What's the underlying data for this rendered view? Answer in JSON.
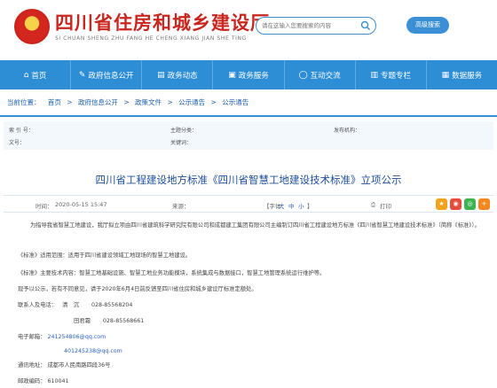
{
  "header": {
    "site_title": "四川省住房和城乡建设厅",
    "site_subtitle": "SI CHUAN SHENG ZHU FANG HE CHENG XIANG JIAN SHE TING",
    "search_placeholder": "请在这输入您要搜索的内容",
    "advanced_search": "高级搜索"
  },
  "nav": {
    "items": [
      {
        "icon": "home-icon",
        "label": "首页"
      },
      {
        "icon": "edit-icon",
        "label": "政府信息公开"
      },
      {
        "icon": "news-icon",
        "label": "政务动态"
      },
      {
        "icon": "service-icon",
        "label": "政务服务"
      },
      {
        "icon": "chat-icon",
        "label": "互动交流"
      },
      {
        "icon": "topic-icon",
        "label": "专题专栏"
      },
      {
        "icon": "data-icon",
        "label": "数据服务"
      }
    ]
  },
  "breadcrumb": {
    "prefix": "当前位置：",
    "items": [
      "首页",
      "政府信息公开",
      "政策文件",
      "公示通告",
      "公示通告"
    ],
    "separator": ">"
  },
  "meta": {
    "index_label": "索 引 号：",
    "index_value": "",
    "category_label": "主题分类：",
    "category_value": "",
    "org_label": "发布机构：",
    "org_value": "",
    "doc_no_label": "文号：",
    "doc_no_value": "",
    "keywords_label": "关键词：",
    "keywords_value": ""
  },
  "article": {
    "title": "四川省工程建设地方标准《四川省智慧工地建设技术标准》立项公示",
    "time_label": "时间：",
    "time_value": "2020-05-15 15:47",
    "source_label": "来源：",
    "source_value": "",
    "font_label": "【字体：",
    "font_options": [
      "大",
      "中",
      "小"
    ],
    "font_close": "】",
    "print_label": "打印",
    "paragraphs": {
      "p1": "为指导我省智慧工地建设，我厅拟立项由四川省建筑科学研究院有限公司和成都建工集团有限公司主编制订四川省工程建设地方标准《四川省智慧工地建设技术标准》（简称《标准》）。",
      "p2": "《标准》适用范围：适用于四川省建设领域工地现场的智慧工地建设。",
      "p3": "《标准》主要技术内容：智慧工地基础设施、智慧工地业务功能模块，系统集成与数据接口，智慧工地管理系统运行维护等。",
      "p4": "现予以公示，若有不同意见，请于2020年6月4日前反馈至四川省住房和城乡建设厅标准定额处。",
      "contact_label": "联系人及电话：",
      "contact1_name": "清　沉",
      "contact1_phone": "028-85568204",
      "contact2_name": "田君霜",
      "contact2_phone": "028-85568661",
      "email_label": "电子邮箱：",
      "email1": "241254806@qq.com",
      "email2": "401245238@qq.com",
      "address_label": "通讯地址：",
      "address_value": "成都市人民南路四段36号",
      "postcode_label": "邮政编码：",
      "postcode_value": "610041"
    }
  },
  "colors": {
    "brand_red": "#c8261e",
    "nav_blue": "#2d8ed6",
    "title_blue": "#1d4f99"
  }
}
